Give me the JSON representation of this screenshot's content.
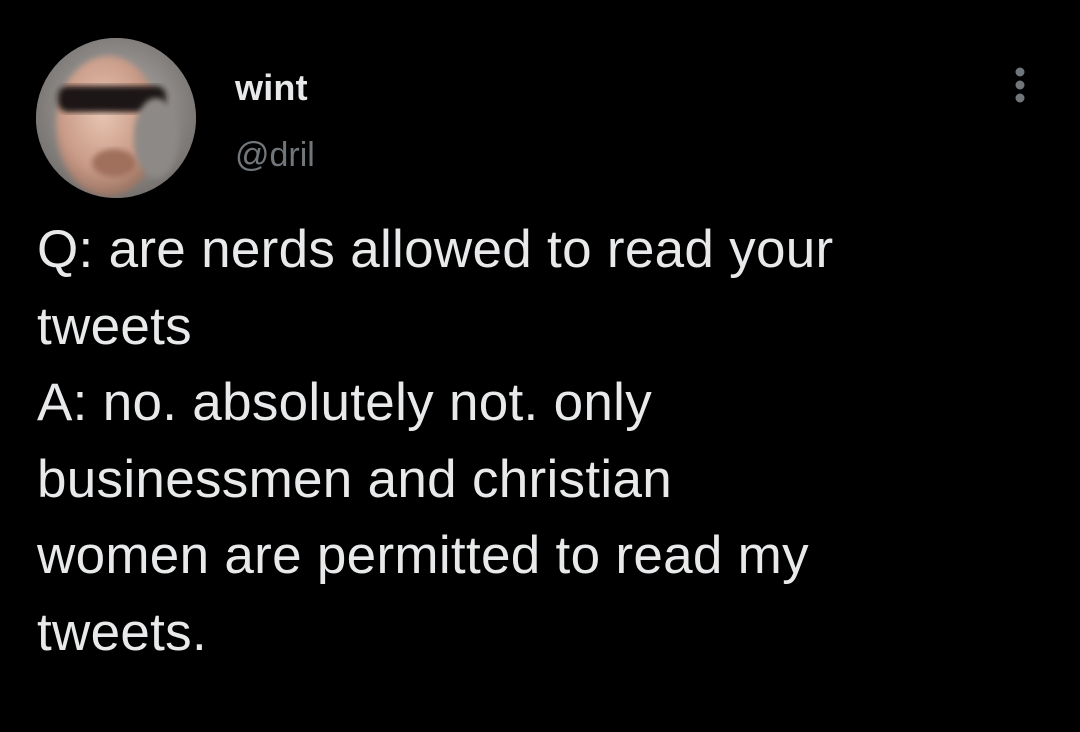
{
  "author": {
    "display_name": "wint",
    "handle": "@dril",
    "avatar_icon": "user-avatar-icon"
  },
  "menu": {
    "icon": "more-options-icon"
  },
  "tweet": {
    "lines": [
      "Q: are nerds allowed to read your",
      "tweets",
      "A: no. absolutely not. only",
      "businessmen and christian",
      "women are permitted to read my",
      "tweets."
    ]
  },
  "colors": {
    "background": "#000000",
    "text_primary": "#e7e9ea",
    "text_secondary": "#71767b"
  }
}
